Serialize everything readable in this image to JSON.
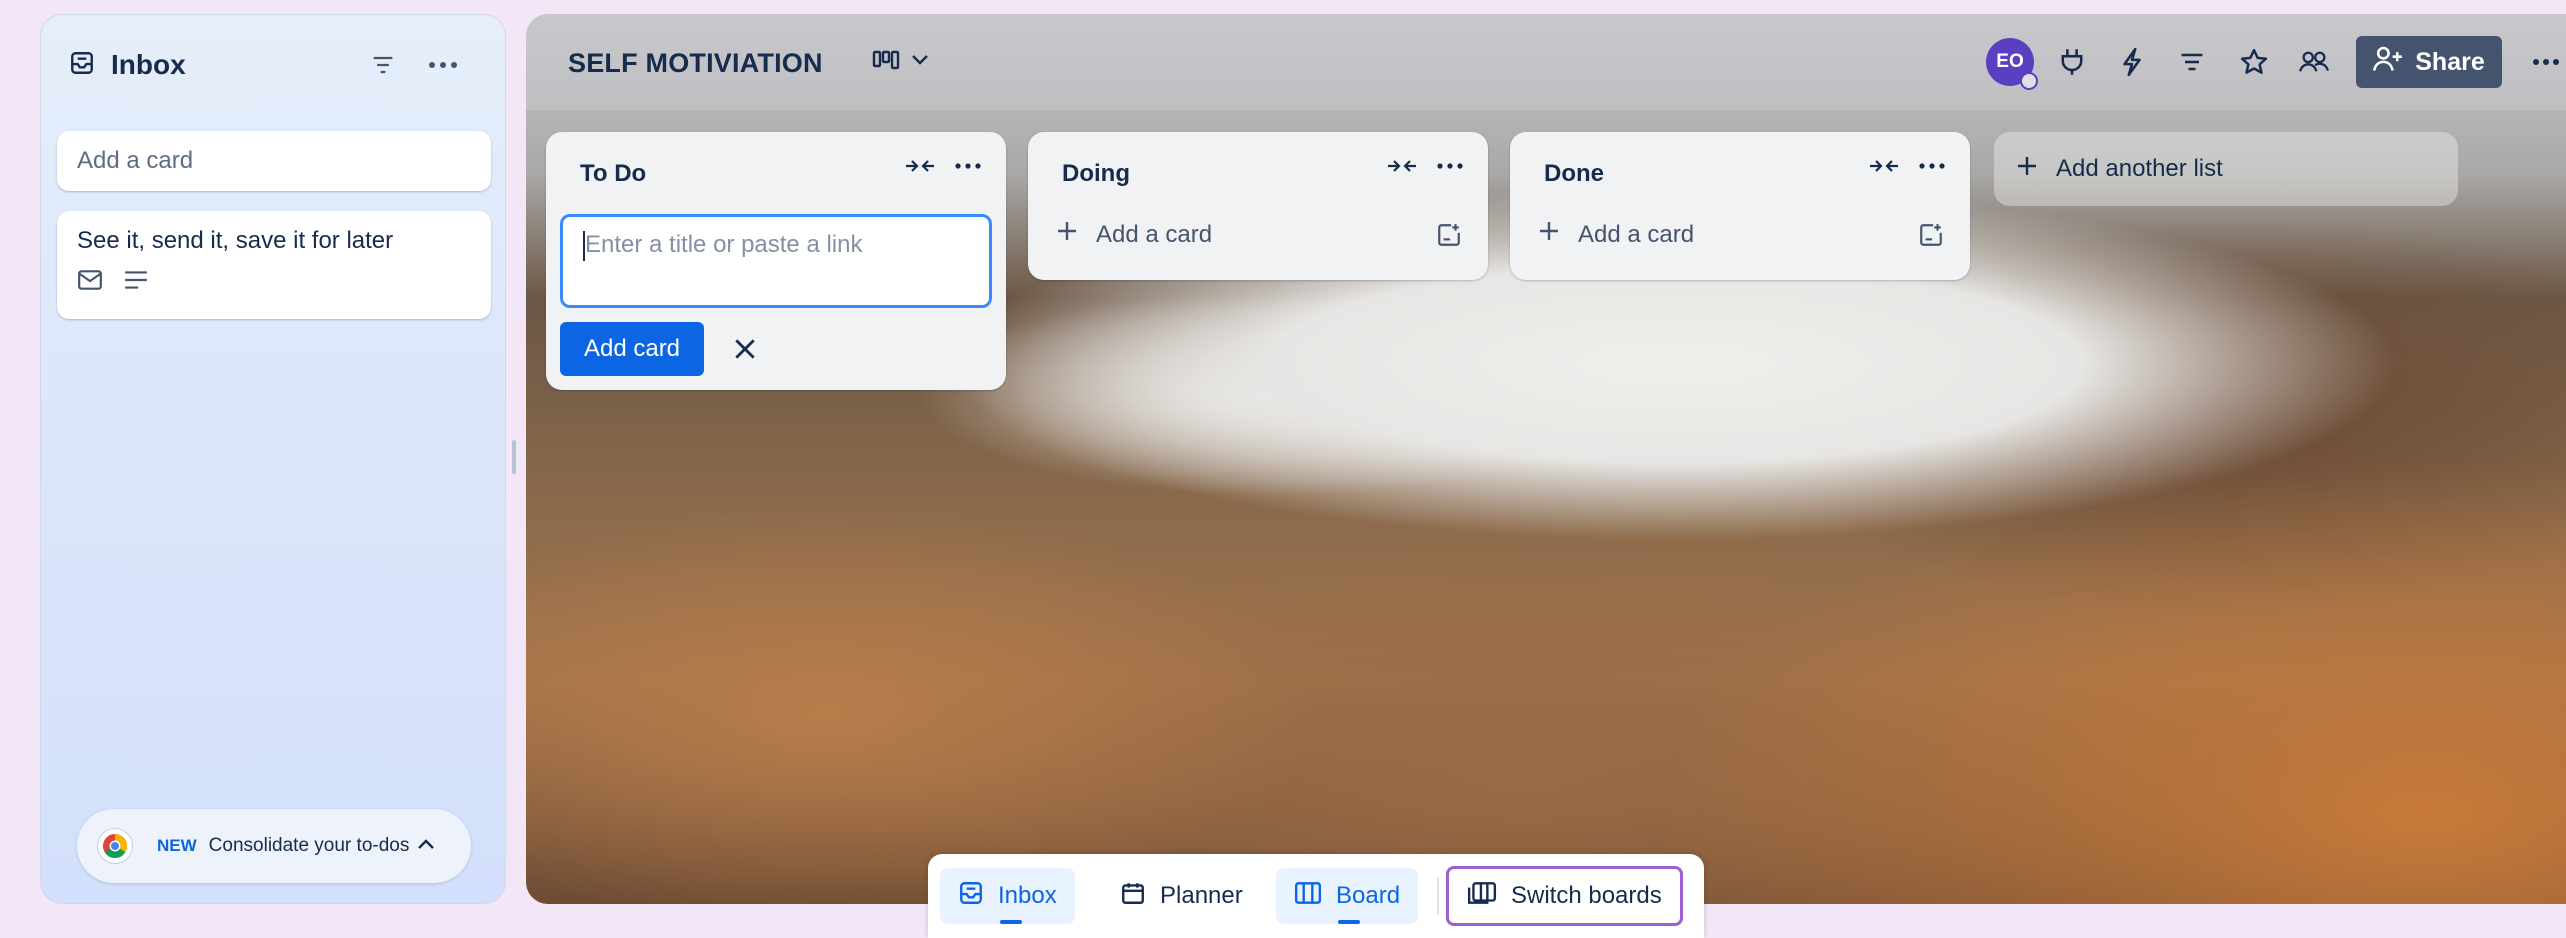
{
  "inbox": {
    "title": "Inbox",
    "add_card_placeholder": "Add a card",
    "card": {
      "title": "See it, send it, save it for later",
      "badges": [
        "email-icon",
        "description-icon"
      ]
    },
    "promo": {
      "tag": "NEW",
      "text": "Consolidate your to-dos"
    }
  },
  "board": {
    "title": "SELF MOTIVIATION",
    "avatar_initials": "EO",
    "share_label": "Share",
    "header_icons": [
      "power-up-icon",
      "automation-icon",
      "filter-icon",
      "star-icon",
      "members-icon",
      "more-icon"
    ],
    "lists": [
      {
        "name": "To Do",
        "composer": {
          "placeholder": "Enter a title or paste a link",
          "add_label": "Add card"
        }
      },
      {
        "name": "Doing",
        "add_label": "Add a card"
      },
      {
        "name": "Done",
        "add_label": "Add a card"
      }
    ],
    "add_list_label": "Add another list"
  },
  "bottom_nav": {
    "items": [
      {
        "label": "Inbox",
        "active": true
      },
      {
        "label": "Planner",
        "active": false
      },
      {
        "label": "Board",
        "active": true
      },
      {
        "label": "Switch boards",
        "active": false
      }
    ]
  },
  "colors": {
    "primary": "#0c66e4",
    "avatar": "#5a3fc0",
    "share_button": "#44546f",
    "switch_boards_outline": "#9f5fd1"
  }
}
